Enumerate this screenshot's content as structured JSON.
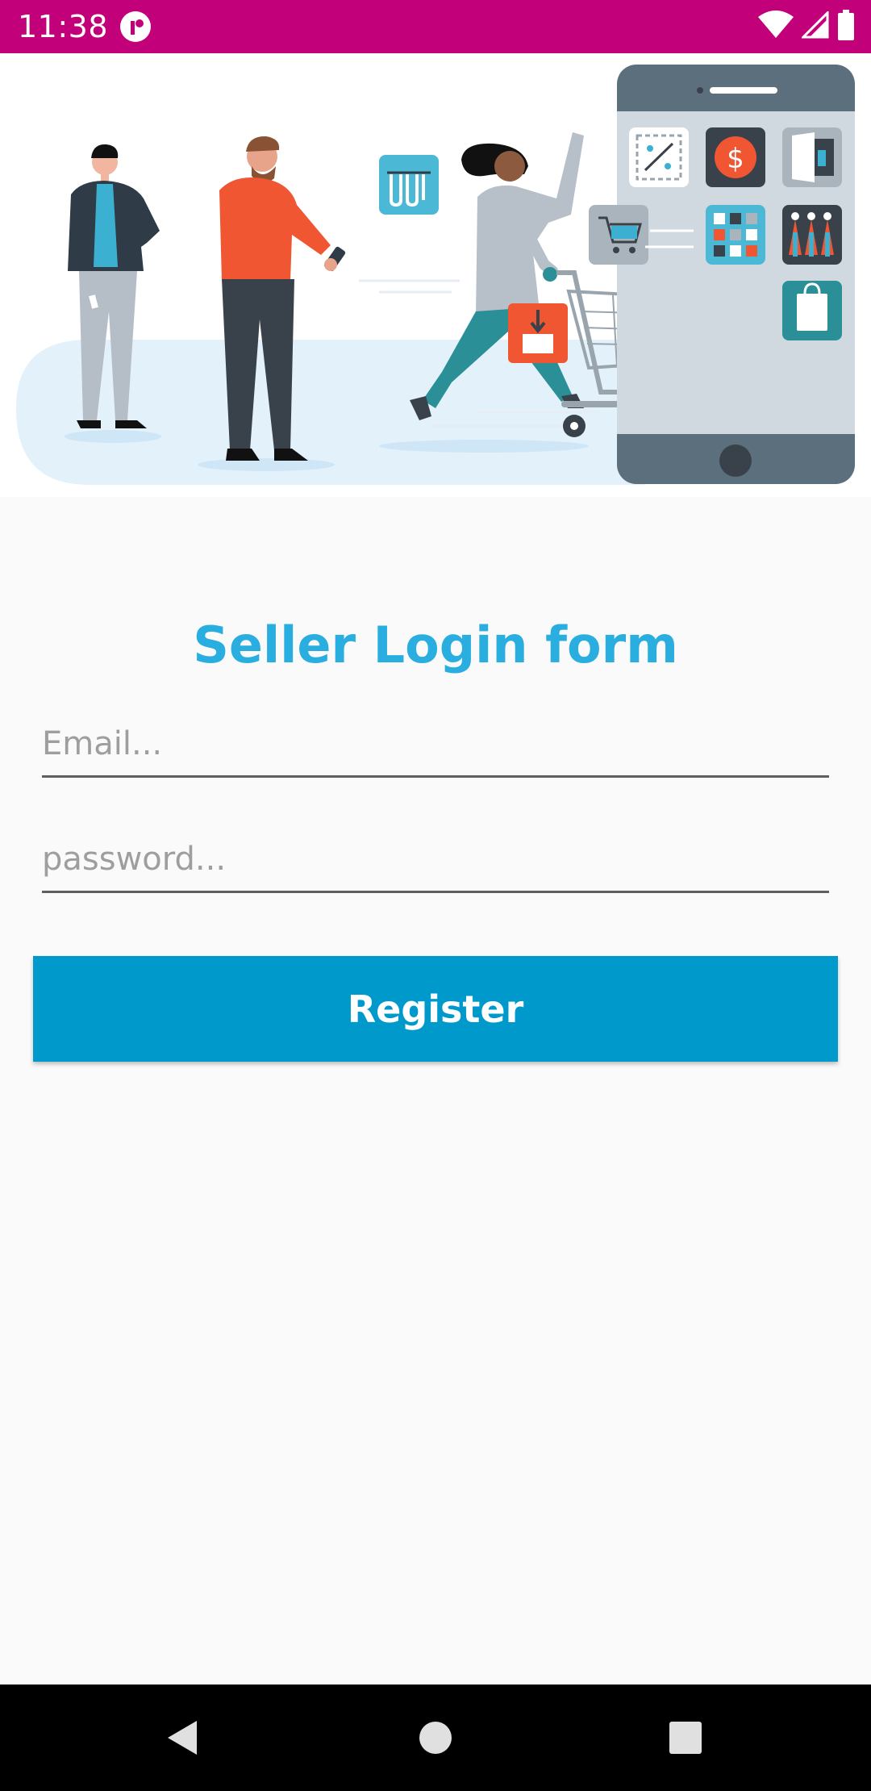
{
  "status_bar": {
    "time": "11:38",
    "icons": [
      "app-notification-icon",
      "wifi-icon",
      "cellular-signal-icon",
      "battery-icon"
    ]
  },
  "hero": {
    "illustration": "online-shopping-illustration"
  },
  "form": {
    "title": "Seller Login form",
    "email_placeholder": "Email...",
    "email_value": "",
    "password_placeholder": "password...",
    "password_value": "",
    "register_label": "Register"
  },
  "nav_bar": {
    "buttons": [
      "back-icon",
      "home-icon",
      "recents-icon"
    ]
  },
  "colors": {
    "status_bar": "#c2007a",
    "title": "#2aaee0",
    "button": "#0099cc",
    "background": "#fafafa"
  }
}
